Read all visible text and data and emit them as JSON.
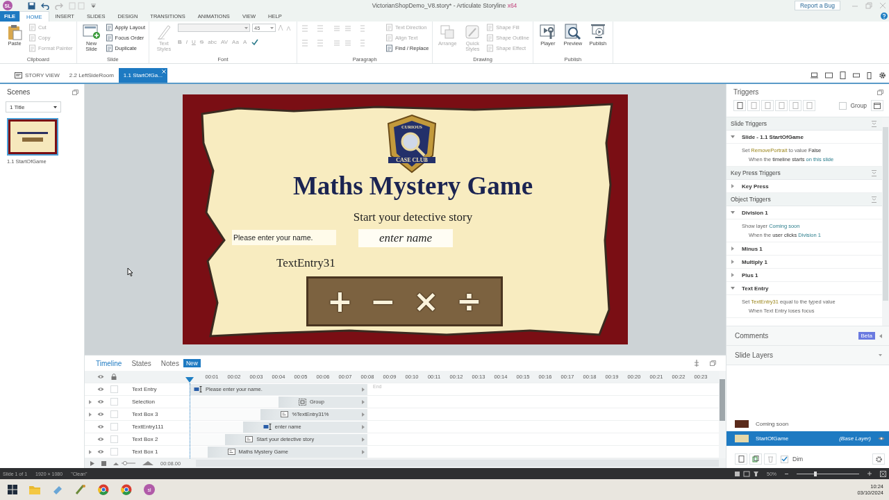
{
  "title_bar": {
    "app_badge": "SL",
    "title": "VictorianShopDemo_V8.story* - Articulate Storyline",
    "edition": "x64",
    "report_button": "Report a Bug"
  },
  "ribbon": {
    "file_tab": "FILE",
    "tabs": [
      {
        "label": "HOME",
        "selected": true
      },
      {
        "label": "INSERT",
        "selected": false
      },
      {
        "label": "SLIDES",
        "selected": false
      },
      {
        "label": "DESIGN",
        "selected": false
      },
      {
        "label": "TRANSITIONS",
        "selected": false
      },
      {
        "label": "ANIMATIONS",
        "selected": false
      },
      {
        "label": "VIEW",
        "selected": false
      },
      {
        "label": "HELP",
        "selected": false
      }
    ],
    "groups": [
      {
        "label": "Clipboard",
        "columns": [
          [
            {
              "kind": "large",
              "label": "Paste",
              "disabled": false
            }
          ],
          [
            {
              "kind": "small",
              "label": "Cut",
              "disabled": true
            },
            {
              "kind": "small",
              "label": "Copy",
              "disabled": true
            },
            {
              "kind": "small",
              "label": "Format Painter",
              "disabled": true
            }
          ]
        ]
      },
      {
        "label": "Slide",
        "columns": [
          [
            {
              "kind": "large",
              "label": "New Slide",
              "disabled": false
            }
          ],
          [
            {
              "kind": "small",
              "label": "Apply Layout",
              "disabled": false
            },
            {
              "kind": "small",
              "label": "Focus Order",
              "disabled": false
            },
            {
              "kind": "small",
              "label": "Duplicate",
              "disabled": false
            }
          ]
        ]
      },
      {
        "label": "Font",
        "columns": [
          [
            {
              "kind": "large",
              "label": "Text Styles",
              "disabled": true
            }
          ],
          [
            {
              "kind": "combos",
              "value": "45"
            },
            {
              "kind": "glyphs",
              "glyphs": [
                "B",
                "I",
                "U",
                "S",
                "abc",
                "AV",
                "Aa",
                "A"
              ],
              "disabled": true
            }
          ]
        ]
      },
      {
        "label": "Paragraph",
        "columns": [
          [
            {
              "kind": "tools"
            },
            {
              "kind": "tools"
            }
          ],
          [
            {
              "kind": "small",
              "label": "Text Direction",
              "disabled": true
            },
            {
              "kind": "small",
              "label": "Align Text",
              "disabled": true
            },
            {
              "kind": "small",
              "label": "Find / Replace",
              "disabled": false
            }
          ]
        ]
      },
      {
        "label": "Drawing",
        "columns": [
          [
            {
              "kind": "large",
              "label": "Arrange",
              "disabled": true
            }
          ],
          [
            {
              "kind": "large",
              "label": "Quick Styles",
              "disabled": true
            }
          ],
          [
            {
              "kind": "small",
              "label": "Shape Fill",
              "disabled": true
            },
            {
              "kind": "small",
              "label": "Shape Outline",
              "disabled": true
            },
            {
              "kind": "small",
              "label": "Shape Effect",
              "disabled": true
            }
          ]
        ]
      },
      {
        "label": "Publish",
        "columns": [
          [
            {
              "kind": "large",
              "label": "Player",
              "disabled": false
            }
          ],
          [
            {
              "kind": "large",
              "label": "Preview",
              "disabled": false
            }
          ],
          [
            {
              "kind": "large",
              "label": "Publish",
              "disabled": false
            }
          ]
        ]
      }
    ]
  },
  "doc_tabs": [
    {
      "label": "STORY VIEW",
      "kind": "story",
      "selected": false
    },
    {
      "label": "2.2 LeftSideRoom",
      "kind": "slide",
      "selected": false
    },
    {
      "label": "1.1 StartOfGa...",
      "kind": "slide",
      "selected": true
    }
  ],
  "scenes": {
    "title": "Scenes",
    "scene_select": "1 Title",
    "slides": [
      {
        "label": "1.1 StartOfGame",
        "selected": true
      }
    ]
  },
  "slide": {
    "badge_top": "CURIOUS",
    "badge_bottom": "CASE CLUB",
    "title": "Maths Mystery Game",
    "subtitle": "Start your detective story",
    "name_prompt": "Please enter your name.",
    "name_entry": "enter name",
    "variable_text": "TextEntry31",
    "operators": [
      "+",
      "−",
      "×",
      "÷"
    ]
  },
  "timeline": {
    "tabs": [
      {
        "label": "Timeline",
        "selected": true
      },
      {
        "label": "States",
        "selected": false
      },
      {
        "label": "Notes",
        "selected": false
      }
    ],
    "new_badge": "New",
    "ticks": [
      "00:01",
      "00:02",
      "00:03",
      "00:04",
      "00:05",
      "00:06",
      "00:07",
      "00:08",
      "00:09",
      "00:10",
      "00:11",
      "00:12",
      "00:13",
      "00:14",
      "00:15",
      "00:16",
      "00:17",
      "00:18",
      "00:19",
      "00:20",
      "00:21",
      "00:22",
      "00:23"
    ],
    "end_label": "End",
    "rows": [
      {
        "name": "Text Entry",
        "expandable": false,
        "locked": false,
        "kind": "entry",
        "bar_label": "Please enter your name.",
        "level": 1
      },
      {
        "name": "Selection",
        "expandable": true,
        "locked": false,
        "kind": "group",
        "bar_label": "Group",
        "level": 0.5
      },
      {
        "name": "Text Box 3",
        "expandable": true,
        "locked": false,
        "kind": "text",
        "bar_label": "%TextEntry31%",
        "level": 0.6
      },
      {
        "name": "TextEntry111",
        "expandable": false,
        "locked": false,
        "kind": "entry",
        "bar_label": "enter name",
        "level": 0.7
      },
      {
        "name": "Text Box 2",
        "expandable": false,
        "locked": false,
        "kind": "text",
        "bar_label": "Start your detective story",
        "level": 0.8
      },
      {
        "name": "Text Box 1",
        "expandable": true,
        "locked": false,
        "kind": "text",
        "bar_label": "Maths Mystery Game",
        "level": 0.9
      }
    ],
    "duration": "00:08.00"
  },
  "triggers": {
    "title": "Triggers",
    "group_label": "Group",
    "group_checked": false,
    "sections": [
      {
        "title": "Slide Triggers",
        "items": [
          {
            "name": "Slide - 1.1 StartOfGame",
            "expanded": true,
            "action": [
              {
                "kind": "plain",
                "text": "Set"
              },
              {
                "kind": "variable",
                "text": "RemovePortrait"
              },
              {
                "kind": "plain",
                "text": "to value"
              },
              {
                "kind": "value",
                "text": "False"
              }
            ],
            "condition": [
              {
                "kind": "plain",
                "text": "When the"
              },
              {
                "kind": "value",
                "text": "timeline starts"
              },
              {
                "kind": "link",
                "text": "on this slide"
              }
            ]
          }
        ]
      },
      {
        "title": "Key Press Triggers",
        "items": [
          {
            "name": "Key Press",
            "expanded": false
          }
        ]
      },
      {
        "title": "Object Triggers",
        "items": [
          {
            "name": "Division 1",
            "expanded": true,
            "action": [
              {
                "kind": "plain",
                "text": "Show layer"
              },
              {
                "kind": "link",
                "text": "Coming soon"
              }
            ],
            "condition": [
              {
                "kind": "plain",
                "text": "When the"
              },
              {
                "kind": "value",
                "text": "user clicks"
              },
              {
                "kind": "link",
                "text": "Division 1"
              }
            ]
          },
          {
            "name": "Minus 1",
            "expanded": false
          },
          {
            "name": "Multiply 1",
            "expanded": false
          },
          {
            "name": "Plus 1",
            "expanded": false
          },
          {
            "name": "Text Entry",
            "expanded": true,
            "action": [
              {
                "kind": "plain",
                "text": "Set"
              },
              {
                "kind": "variable",
                "text": "TextEntry31"
              },
              {
                "kind": "plain",
                "text": "equal to the typed value"
              }
            ],
            "condition": [
              {
                "kind": "plain",
                "text": "When Text Entry loses focus"
              }
            ]
          }
        ]
      }
    ]
  },
  "comments": {
    "title": "Comments",
    "badge": "Beta"
  },
  "layers": {
    "title": "Slide Layers",
    "items": [
      {
        "name": "Coming soon",
        "selected": false
      },
      {
        "name": "StartOfGame",
        "note": "(Base Layer)",
        "selected": true
      }
    ],
    "dim_label": "Dim",
    "dim_checked": true
  },
  "status_bar": {
    "slide_count": "Slide 1 of 1",
    "size": "1920 × 1080",
    "theme": "\"Clean\"",
    "zoom": "50%",
    "zoom_slider": {
      "level": 0.3
    }
  },
  "taskbar": {
    "app_label": "sl",
    "time": "10:24",
    "date": "03/10/2024"
  }
}
